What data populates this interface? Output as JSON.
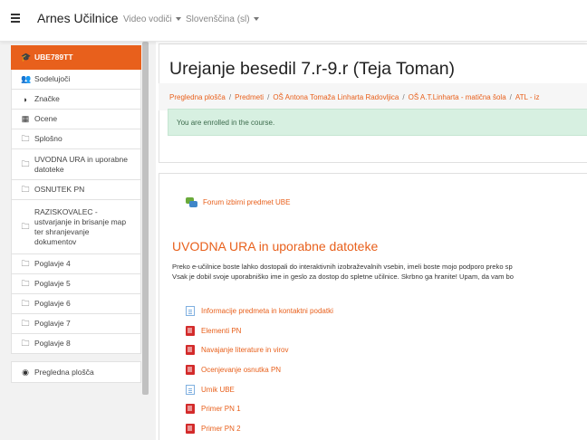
{
  "navbar": {
    "site_name": "Arnes Učilnice",
    "menu_video": "Video vodiči",
    "menu_language": "Slovenščina (sl)"
  },
  "sidebar": {
    "items": [
      {
        "icon": "graduation-cap-icon",
        "glyph": "🎓",
        "label": "UBE789TT",
        "active": true
      },
      {
        "icon": "users-icon",
        "glyph": "👥",
        "label": "Sodelujoči"
      },
      {
        "icon": "badge-icon",
        "glyph": "◗",
        "label": "Značke"
      },
      {
        "icon": "grid-icon",
        "glyph": "▦",
        "label": "Ocene"
      },
      {
        "icon": "folder-icon",
        "glyph": "🗀",
        "label": "Splošno"
      },
      {
        "icon": "folder-icon",
        "glyph": "🗀",
        "label": "UVODNA URA in uporabne datoteke"
      },
      {
        "icon": "folder-icon",
        "glyph": "🗀",
        "label": "OSNUTEK PN"
      },
      {
        "icon": "folder-icon",
        "glyph": "🗀",
        "label": "RAZISKOVALEC - ustvarjanje in brisanje map ter shranjevanje dokumentov"
      },
      {
        "icon": "folder-icon",
        "glyph": "🗀",
        "label": "Poglavje 4"
      },
      {
        "icon": "folder-icon",
        "glyph": "🗀",
        "label": "Poglavje 5"
      },
      {
        "icon": "folder-icon",
        "glyph": "🗀",
        "label": "Poglavje 6"
      },
      {
        "icon": "folder-icon",
        "glyph": "🗀",
        "label": "Poglavje 7"
      },
      {
        "icon": "folder-icon",
        "glyph": "🗀",
        "label": "Poglavje 8"
      }
    ],
    "dashboard": {
      "icon": "dashboard-icon",
      "glyph": "◉",
      "label": "Pregledna plošča"
    }
  },
  "page": {
    "title": "Urejanje besedil 7.r-9.r (Teja Toman)",
    "breadcrumb": [
      "Pregledna plošča",
      "Predmeti",
      "OŠ Antona Tomaža Linharta Radovljica",
      "OŠ A.T.Linharta - matična šola",
      "ATL - iz"
    ]
  },
  "content": {
    "enrolled_notice": "You are enrolled in the course.",
    "forum_link": "Forum izbirni predmet UBE",
    "section_title": "UVODNA URA in uporabne datoteke",
    "section_text": [
      "Preko e-učilnice boste lahko dostopali do interaktivnih izobraževalnih vsebin, imeli boste mojo podporo preko sp",
      "Vsak je dobil svoje uporabniško ime in geslo za dostop do spletne učilnice. Skrbno ga hranite! Upam, da vam bo"
    ],
    "resources": [
      {
        "type": "doc",
        "icon": "document-icon",
        "label": "Informacije predmeta in kontaktni podatki"
      },
      {
        "type": "pdf",
        "icon": "pdf-icon",
        "label": "Elementi PN"
      },
      {
        "type": "pdf",
        "icon": "pdf-icon",
        "label": "Navajanje literature in virov"
      },
      {
        "type": "pdf",
        "icon": "pdf-icon",
        "label": "Ocenjevanje osnutka PN"
      },
      {
        "type": "doc",
        "icon": "document-icon",
        "label": "Umik UBE"
      },
      {
        "type": "pdf",
        "icon": "pdf-icon",
        "label": "Primer PN 1"
      },
      {
        "type": "pdf",
        "icon": "pdf-icon",
        "label": "Primer PN 2"
      }
    ]
  }
}
